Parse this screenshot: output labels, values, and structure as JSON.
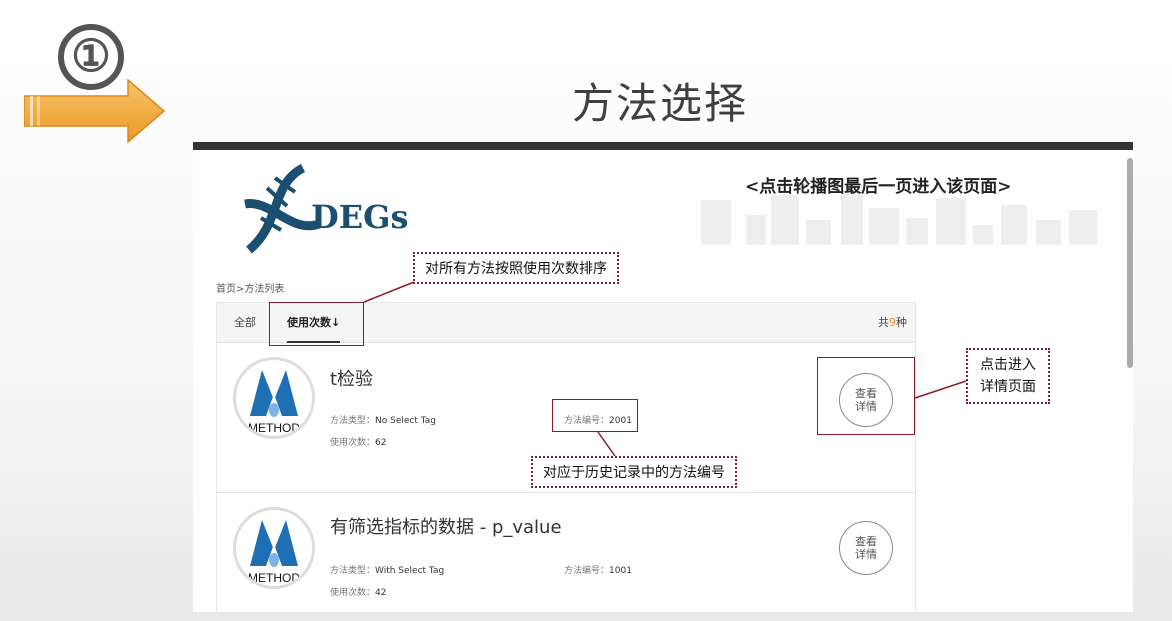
{
  "slide": {
    "step_number": "①",
    "title": "方法选择"
  },
  "banner": {
    "logo_text": "DEGs",
    "note": "<点击轮播图最后一页进入该页面>"
  },
  "breadcrumb": "首页>方法列表",
  "tabs": [
    {
      "label": "全部"
    },
    {
      "label": "使用次数↓"
    }
  ],
  "total": {
    "prefix": "共",
    "count": "9",
    "suffix": "种"
  },
  "methods": [
    {
      "title": "t检验",
      "type_label": "方法类型：",
      "type_value": "No Select Tag",
      "code_label": "方法编号：",
      "code_value": "2001",
      "usage_label": "使用次数：",
      "usage_value": "62",
      "button_line1": "查看",
      "button_line2": "详情"
    },
    {
      "title": "有筛选指标的数据 - p_value",
      "type_label": "方法类型：",
      "type_value": "With Select Tag",
      "code_label": "方法编号：",
      "code_value": "1001",
      "usage_label": "使用次数：",
      "usage_value": "42",
      "button_line1": "查看",
      "button_line2": "详情"
    }
  ],
  "thumb_text": "METHOD",
  "annotations": {
    "sort_note": "对所有方法按照使用次数排序",
    "code_note": "对应于历史记录中的方法编号",
    "detail_note_line1": "点击进入",
    "detail_note_line2": "详情页面"
  },
  "colors": {
    "arrow": "#f2a93b",
    "annotation": "#8b1a2b",
    "accent_count": "#f08a24",
    "logo": "#1b4f72"
  }
}
